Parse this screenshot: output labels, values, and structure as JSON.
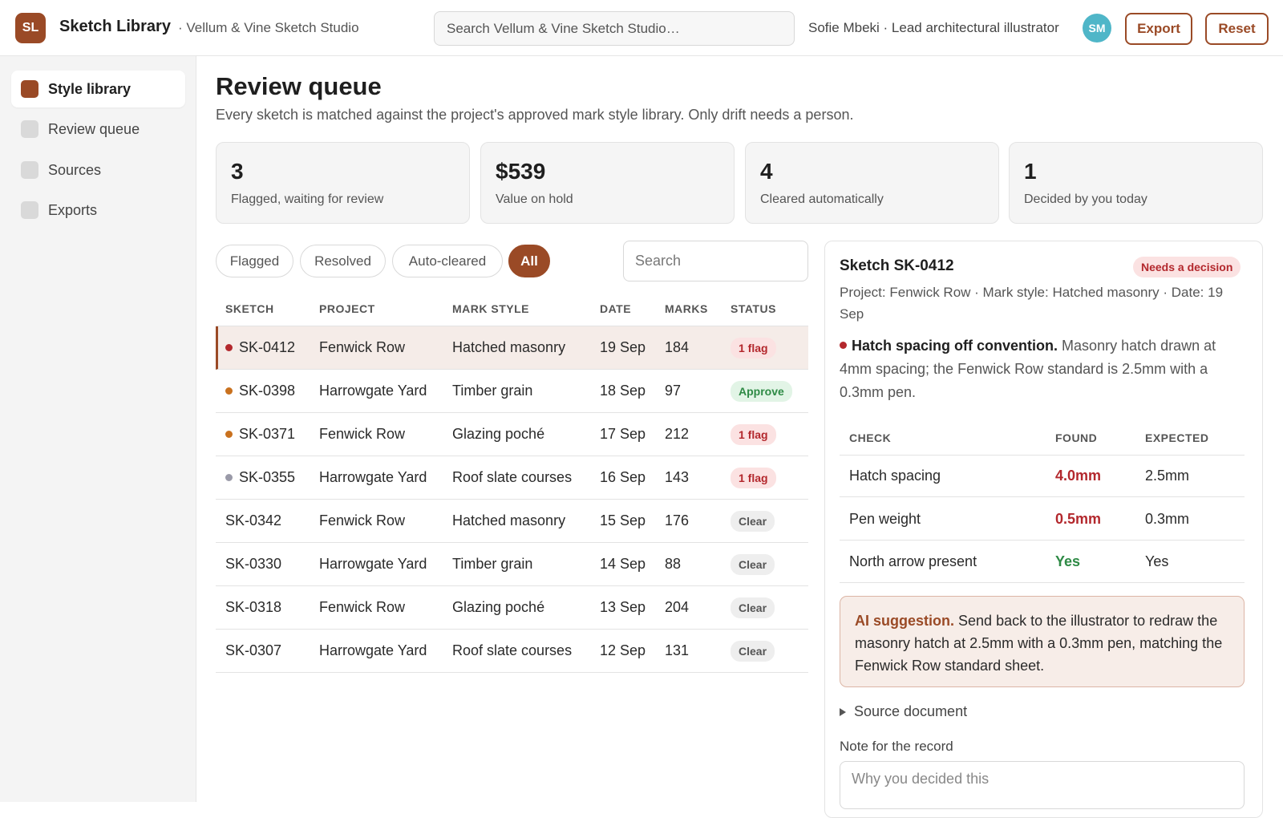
{
  "app": {
    "logo": "SL",
    "title": "Sketch Library",
    "studio": "· Vellum & Vine Sketch Studio",
    "search_placeholder": "Search Vellum & Vine Sketch Studio…",
    "user": "Sofie Mbeki · Lead architectural illustrator",
    "avatar": "SM",
    "export_label": "Export",
    "reset_label": "Reset"
  },
  "sidebar": {
    "items": [
      {
        "label": "Style library",
        "active": true
      },
      {
        "label": "Review queue",
        "active": false
      },
      {
        "label": "Sources",
        "active": false
      },
      {
        "label": "Exports",
        "active": false
      }
    ]
  },
  "page": {
    "title": "Review queue",
    "subtitle": "Every sketch is matched against the project's approved mark style library. Only drift needs a person."
  },
  "stats": [
    {
      "value": "3",
      "label": "Flagged, waiting for review"
    },
    {
      "value": "$539",
      "label": "Value on hold"
    },
    {
      "value": "4",
      "label": "Cleared automatically"
    },
    {
      "value": "1",
      "label": "Decided by you today"
    }
  ],
  "filters": [
    {
      "label": "Flagged",
      "active": false
    },
    {
      "label": "Resolved",
      "active": false
    },
    {
      "label": "Auto-cleared",
      "active": false
    },
    {
      "label": "All",
      "active": true
    }
  ],
  "table_search_placeholder": "Search",
  "table": {
    "columns": [
      "SKETCH",
      "PROJECT",
      "MARK STYLE",
      "DATE",
      "MARKS",
      "STATUS"
    ],
    "rows": [
      {
        "sketch": "SK-0412",
        "project": "Fenwick Row",
        "style": "Hatched masonry",
        "date": "19 Sep",
        "marks": "184",
        "status": "1 flag",
        "kind": "flag",
        "dot": "#b3282d"
      },
      {
        "sketch": "SK-0398",
        "project": "Harrowgate Yard",
        "style": "Timber grain",
        "date": "18 Sep",
        "marks": "97",
        "status": "Approve",
        "kind": "approve",
        "dot": "#c9711e"
      },
      {
        "sketch": "SK-0371",
        "project": "Fenwick Row",
        "style": "Glazing poché",
        "date": "17 Sep",
        "marks": "212",
        "status": "1 flag",
        "kind": "flag",
        "dot": "#c9711e"
      },
      {
        "sketch": "SK-0355",
        "project": "Harrowgate Yard",
        "style": "Roof slate courses",
        "date": "16 Sep",
        "marks": "143",
        "status": "1 flag",
        "kind": "flag",
        "dot": "#9a9aa8"
      },
      {
        "sketch": "SK-0342",
        "project": "Fenwick Row",
        "style": "Hatched masonry",
        "date": "15 Sep",
        "marks": "176",
        "status": "Clear",
        "kind": "clear",
        "dot": ""
      },
      {
        "sketch": "SK-0330",
        "project": "Harrowgate Yard",
        "style": "Timber grain",
        "date": "14 Sep",
        "marks": "88",
        "status": "Clear",
        "kind": "clear",
        "dot": ""
      },
      {
        "sketch": "SK-0318",
        "project": "Fenwick Row",
        "style": "Glazing poché",
        "date": "13 Sep",
        "marks": "204",
        "status": "Clear",
        "kind": "clear",
        "dot": ""
      },
      {
        "sketch": "SK-0307",
        "project": "Harrowgate Yard",
        "style": "Roof slate courses",
        "date": "12 Sep",
        "marks": "131",
        "status": "Clear",
        "kind": "clear",
        "dot": ""
      }
    ]
  },
  "detail": {
    "title": "Sketch SK-0412",
    "badge": "Needs a decision",
    "meta": "Project: Fenwick Row · Mark style: Hatched masonry · Date: 19 Sep",
    "finding_title": "Hatch spacing off convention.",
    "finding_text": "Masonry hatch drawn at 4mm spacing; the Fenwick Row standard is 2.5mm with a 0.3mm pen.",
    "check_columns": [
      "CHECK",
      "FOUND",
      "EXPECTED"
    ],
    "checks": [
      {
        "check": "Hatch spacing",
        "found": "4.0mm",
        "expected": "2.5mm",
        "ok": false
      },
      {
        "check": "Pen weight",
        "found": "0.5mm",
        "expected": "0.3mm",
        "ok": false
      },
      {
        "check": "North arrow present",
        "found": "Yes",
        "expected": "Yes",
        "ok": true
      }
    ],
    "ai_label": "AI suggestion.",
    "ai_text": "Send back to the illustrator to redraw the masonry hatch at 2.5mm with a 0.3mm pen, matching the Fenwick Row standard sheet.",
    "source_toggle": "Source document",
    "note_label": "Note for the record",
    "note_placeholder": "Why you decided this"
  },
  "colors": {
    "accent": "#9a4a26",
    "flag": "#b3282d",
    "approve": "#2e8a45",
    "avatar": "#4fb6c8"
  }
}
